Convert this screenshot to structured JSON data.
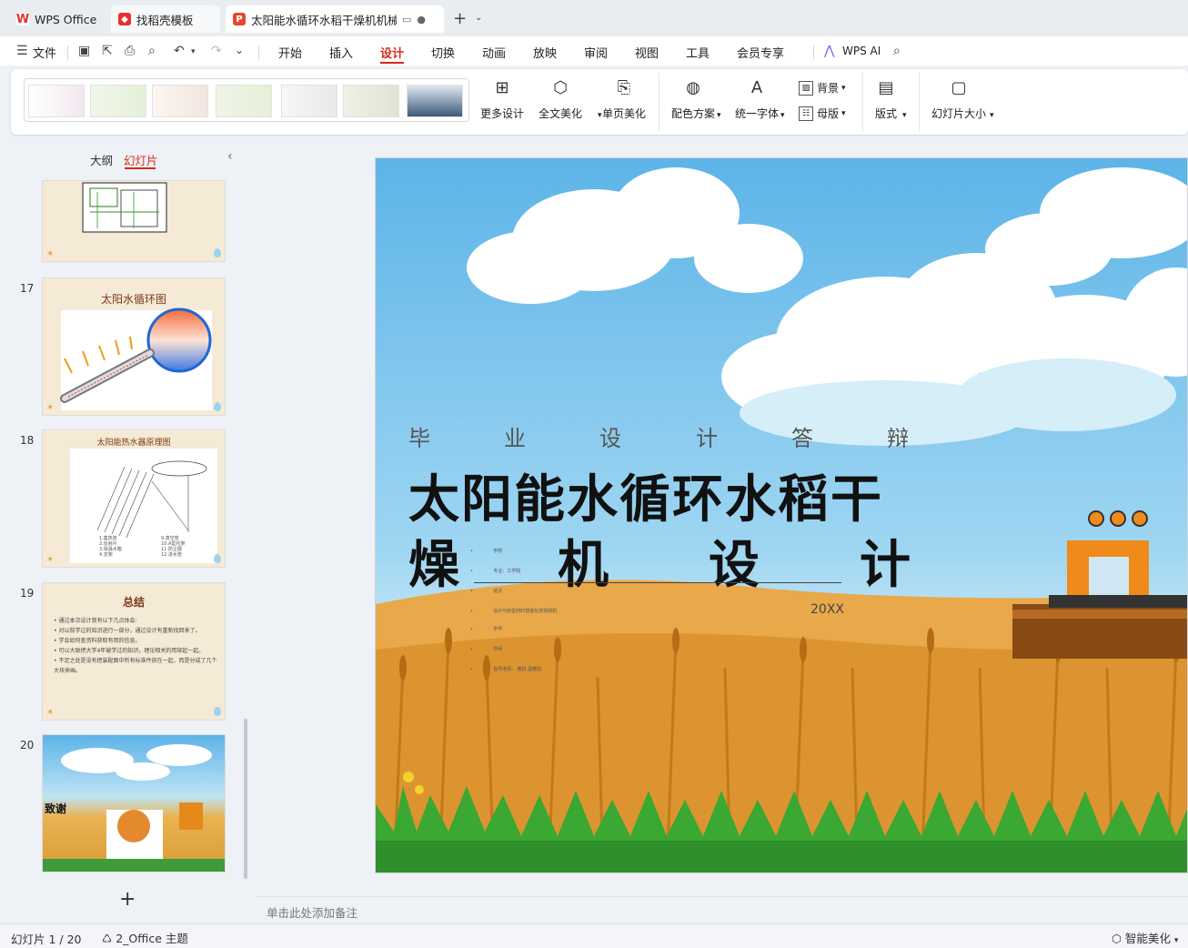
{
  "tabs": {
    "wps": "WPS Office",
    "template": "找稻壳模板",
    "doc": "太阳能水循环水稻干燥机机械设计"
  },
  "menu": {
    "file": "文件",
    "items": [
      "开始",
      "插入",
      "设计",
      "切换",
      "动画",
      "放映",
      "审阅",
      "视图",
      "工具",
      "会员专享"
    ],
    "active": "设计",
    "ai": "WPS AI"
  },
  "ribbon": {
    "more_design": "更多设计",
    "full_beautify": "全文美化",
    "page_beautify": "单页美化",
    "color_scheme": "配色方案",
    "unify_font": "统一字体",
    "background": "背景",
    "master": "母版",
    "layout": "版式",
    "slide_size": "幻灯片大小"
  },
  "panel": {
    "outline_tab": "大纲",
    "slides_tab": "幻灯片",
    "thumbs": [
      {
        "num": "",
        "title": ""
      },
      {
        "num": "17",
        "title": "太阳水循环图"
      },
      {
        "num": "18",
        "title": "太阳能热水器原理图"
      },
      {
        "num": "19",
        "title": "总结"
      },
      {
        "num": "20",
        "title": "致谢"
      }
    ],
    "summary_lines": [
      "• 通过本次设计我有以下几点体会:",
      "• 对以前学过的知识进行一部分，通过设计有重新找回来了。",
      "• 学会如何查资料获取有用的信息。",
      "• 可以大致把大学4年被学过的知识，理论相关的用穿起一起。",
      "• 不足之处是没有把装配图中所有标准件放在一起，而是分成了几个大块来画。"
    ]
  },
  "slide": {
    "subtitle_chars": [
      "毕",
      "业",
      "设",
      "计",
      "答",
      "辩"
    ],
    "title_line1": "太阳能水循环水稻干",
    "title_line2_chars": [
      "燥",
      "机",
      "设",
      "计"
    ],
    "year": "20XX",
    "bullets": [
      "学校",
      "专业：工学院",
      "班次",
      "设计与新型材料智能化高效烘机",
      "学号",
      "导师",
      "指导老师：   教授   副教授"
    ]
  },
  "notes_placeholder": "单击此处添加备注",
  "status": {
    "slide_indicator": "幻灯片 1 / 20",
    "theme": "2_Office 主题",
    "beautify": "智能美化"
  },
  "colors": {
    "accent": "#d9291c",
    "selection": "#3d6ee8"
  }
}
